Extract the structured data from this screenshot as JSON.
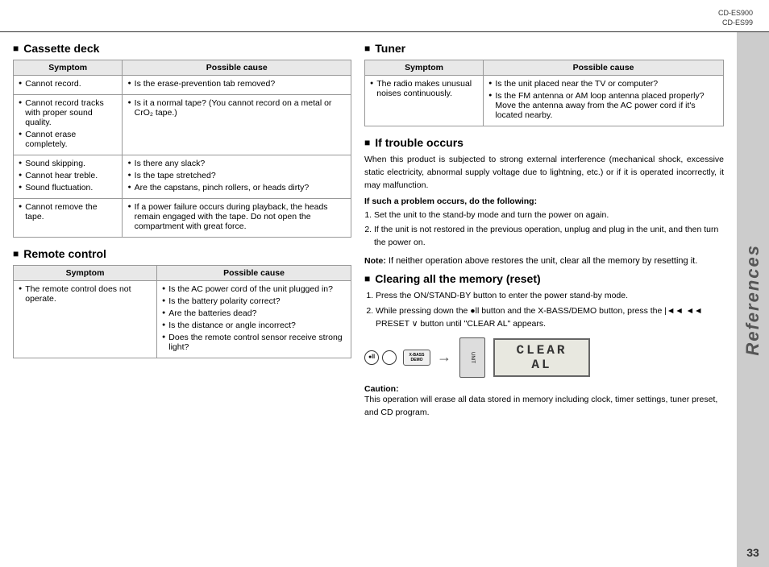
{
  "header": {
    "model1": "CD-ES900",
    "model2": "CD-ES99"
  },
  "page_number": "33",
  "side_label": "References",
  "cassette_section": {
    "title": "Cassette deck",
    "table": {
      "col1": "Symptom",
      "col2": "Possible cause",
      "rows": [
        {
          "symptom": [
            "Cannot record."
          ],
          "cause": [
            "Is the erase-prevention tab removed?"
          ]
        },
        {
          "symptom": [
            "Cannot record tracks with proper sound quality.",
            "Cannot erase completely."
          ],
          "cause": [
            "Is it a normal tape? (You cannot record on a metal or CrO₂ tape.)"
          ]
        },
        {
          "symptom": [
            "Sound skipping.",
            "Cannot hear treble.",
            "Sound fluctuation."
          ],
          "cause": [
            "Is there any slack?",
            "Is the tape stretched?",
            "Are the capstans, pinch rollers, or heads dirty?"
          ]
        },
        {
          "symptom": [
            "Cannot remove the tape."
          ],
          "cause": [
            "If a power failure occurs during playback, the heads remain engaged with the tape. Do not open the compartment with great force."
          ]
        }
      ]
    }
  },
  "remote_section": {
    "title": "Remote control",
    "table": {
      "col1": "Symptom",
      "col2": "Possible cause",
      "rows": [
        {
          "symptom": [
            "The remote control does not operate."
          ],
          "cause": [
            "Is the AC power cord of the unit plugged in?",
            "Is the battery polarity correct?",
            "Are the batteries dead?",
            "Is the distance or angle incorrect?",
            "Does the remote control sensor receive strong light?"
          ]
        }
      ]
    }
  },
  "tuner_section": {
    "title": "Tuner",
    "table": {
      "col1": "Symptom",
      "col2": "Possible cause",
      "rows": [
        {
          "symptom": [
            "The radio makes unusual noises continuously."
          ],
          "cause": [
            "Is the unit placed near the TV or computer?",
            "Is the FM antenna or AM loop antenna placed properly? Move the antenna away from the AC power cord if it's located nearby."
          ]
        }
      ]
    }
  },
  "trouble_section": {
    "title": "If trouble occurs",
    "description": "When this product is subjected to strong external interference (mechanical shock, excessive static electricity, abnormal supply voltage due to lightning, etc.) or if it is operated incorrectly, it may malfunction.",
    "bold_instruction": "If such a problem occurs, do the following:",
    "steps": [
      "Set the unit to the stand-by mode and turn the power on again.",
      "If the unit is not restored in the previous operation, unplug and plug in the unit, and then turn the power on."
    ],
    "note_title": "Note:",
    "note_text": "If neither operation above restores the unit, clear all the memory by resetting it."
  },
  "reset_section": {
    "title": "Clearing all the memory (reset)",
    "steps": [
      "Press the ON/STAND-BY button to enter the power stand-by mode.",
      "While pressing down the ●ll button and the X-BASS/DEMO button, press the |◄◄ ◄◄ PRESET ∨ button until \"CLEAR AL\" appears."
    ],
    "display_text": "CLEAR AL",
    "caution_title": "Caution:",
    "caution_text": "This operation will erase all data stored in memory including clock, timer settings, tuner preset, and CD program."
  }
}
